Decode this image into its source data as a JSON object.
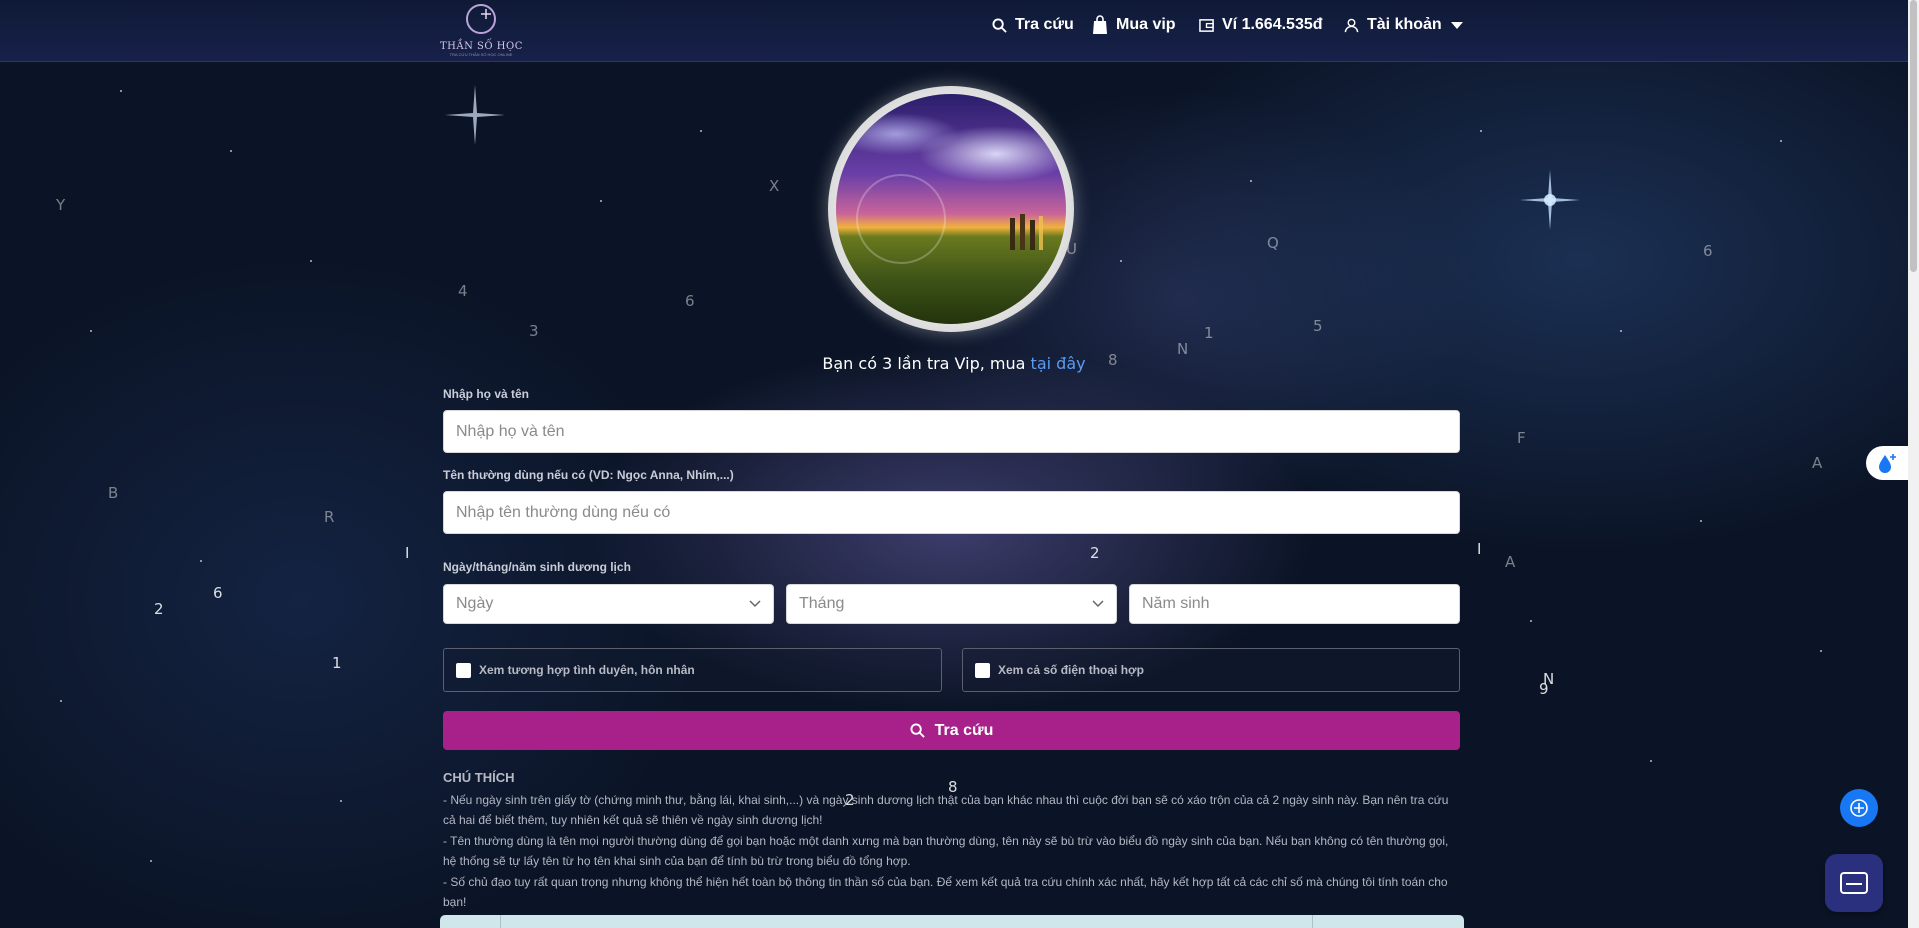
{
  "header": {
    "logo_text": "THẦN SỐ HỌC",
    "logo_subtext": "TRA CỨU THẦN SỐ HỌC ONLINE",
    "nav": {
      "search_label": "Tra cứu",
      "vip_label": "Mua vip",
      "wallet_label": "Ví 1.664.535đ",
      "account_label": "Tài khoản"
    }
  },
  "vip_notice": {
    "text": "Bạn có 3 lần tra Vip, mua ",
    "link_text": "tại đây"
  },
  "form": {
    "full_name": {
      "label": "Nhập họ và tên",
      "placeholder": "Nhập họ và tên"
    },
    "nickname": {
      "label": "Tên thường dùng nếu có (VD: Ngọc Anna, Nhím,...)",
      "placeholder": "Nhập tên thường dùng nếu có"
    },
    "birthdate": {
      "label": "Ngày/tháng/năm sinh dương lịch",
      "day_placeholder": "Ngày",
      "month_placeholder": "Tháng",
      "year_placeholder": "Năm sinh"
    },
    "option_marriage": "Xem tương hợp tình duyên, hôn nhân",
    "option_phone": "Xem cả số điện thoại hợp",
    "submit_label": "Tra cứu"
  },
  "notes": {
    "title": "CHÚ THÍCH",
    "lines": [
      "- Nếu ngày sinh trên giấy tờ (chứng minh thư, bằng lái, khai sinh,...) và ngày sinh dương lịch thật của bạn khác nhau thì cuộc đời bạn sẽ có xáo trộn của cả 2 ngày sinh này. Bạn nên tra cứu cả hai để biết thêm, tuy nhiên kết quả sẽ thiên về ngày sinh dương lịch!",
      "- Tên thường dùng là tên mọi người thường dùng để gọi bạn hoặc một danh xưng mà bạn thường dùng, tên này sẽ bù trừ vào biểu đồ ngày sinh của bạn. Nếu bạn không có tên thường gọi, hệ thống sẽ tự lấy tên từ họ tên khai sinh của bạn để tính bù trừ trong biểu đồ tổng hợp.",
      "- Số chủ đạo tuy rất quan trọng nhưng không thể hiện hết toàn bộ thông tin thần số của bạn. Để xem kết quả tra cứu chính xác nhất, hãy kết hợp tất cả các chỉ số mà chúng tôi tính toán cho bạn!"
    ]
  },
  "floating_chars": [
    "Y",
    "4",
    "3",
    "6",
    "X",
    "Q",
    "5",
    "N",
    "1",
    "8",
    "6",
    "F",
    "A",
    "B",
    "R",
    "I",
    "2",
    "6",
    "1",
    "2",
    "I",
    "A",
    "N",
    "9",
    "8",
    "2",
    "U"
  ],
  "colors": {
    "submit": "#a8208a",
    "link": "#5b9cf0",
    "fab_plus": "#1877f2",
    "fab_mail": "#2a2f7e"
  }
}
